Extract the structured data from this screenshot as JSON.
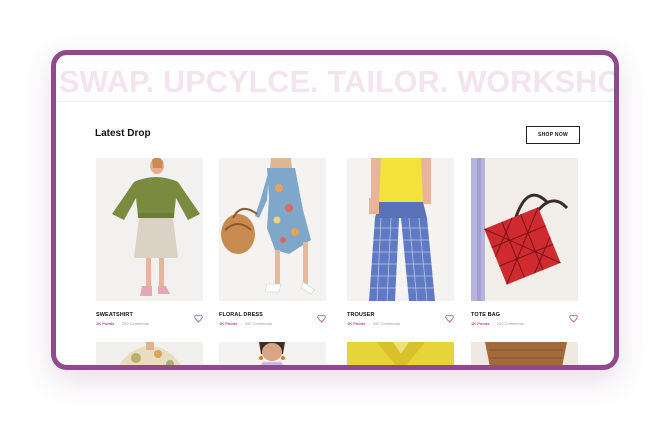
{
  "banner": {
    "text": "SWAP. UPCYLCE. TAILOR. WORKSHOPS",
    "color": "#f3e4ef"
  },
  "theme": {
    "accent": "#b5479c",
    "frame": "#8f4a8c"
  },
  "section": {
    "title": "Latest Drop",
    "shop_button": "SHOP NOW"
  },
  "products": [
    {
      "name": "SWEATSHIRT",
      "points": "1K Points",
      "comments": "200 Comments"
    },
    {
      "name": "FLORAL DRESS",
      "points": "1K Points",
      "comments": "200 Comments"
    },
    {
      "name": "TROUSER",
      "points": "1K Points",
      "comments": "200 Comments"
    },
    {
      "name": "TOTE BAG",
      "points": "1K Points",
      "comments": "200 Comments"
    }
  ],
  "icons": {
    "favorite": "heart-icon"
  }
}
